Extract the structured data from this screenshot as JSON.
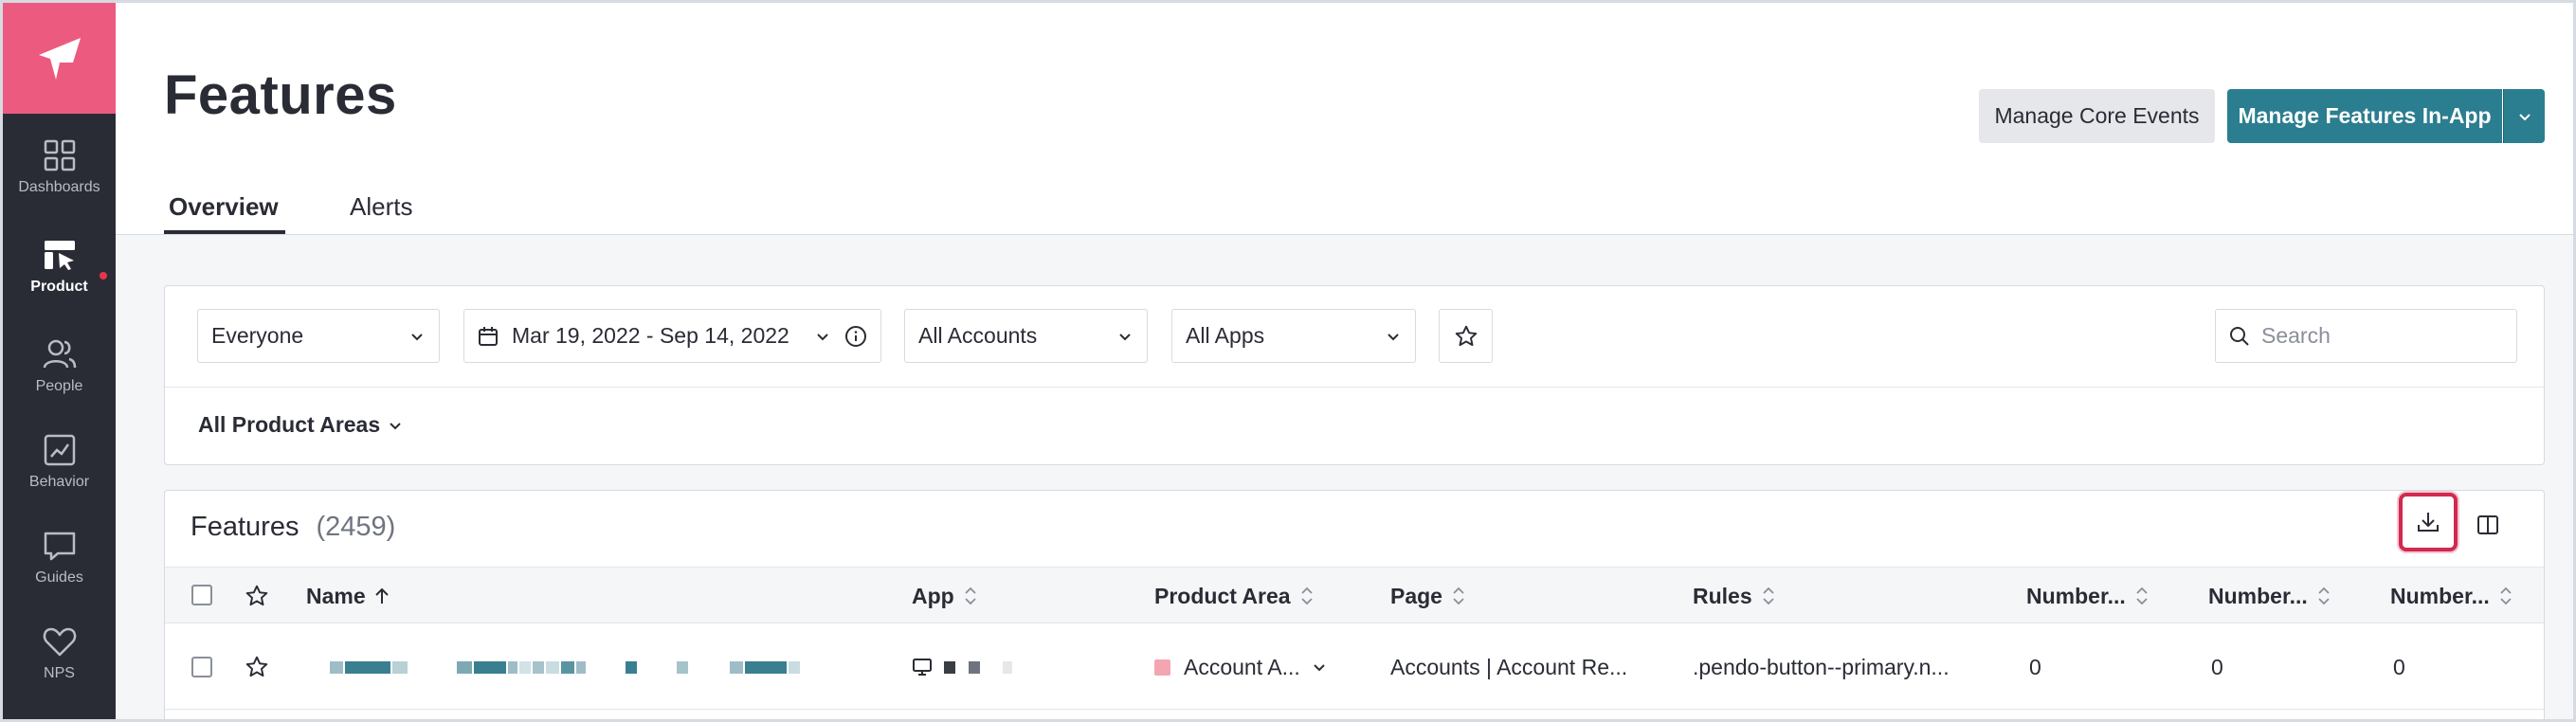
{
  "sidebar": {
    "items": [
      {
        "label": "Dashboards",
        "icon": "grid-icon",
        "active": false
      },
      {
        "label": "Product",
        "icon": "product-icon",
        "active": true,
        "notification": true
      },
      {
        "label": "People",
        "icon": "people-icon",
        "active": false
      },
      {
        "label": "Behavior",
        "icon": "chart-icon",
        "active": false
      },
      {
        "label": "Guides",
        "icon": "message-icon",
        "active": false
      },
      {
        "label": "NPS",
        "icon": "heart-icon",
        "active": false
      }
    ]
  },
  "header": {
    "title": "Features",
    "secondary_button": "Manage Core Events",
    "primary_button": "Manage Features In-App"
  },
  "tabs": [
    {
      "label": "Overview",
      "active": true
    },
    {
      "label": "Alerts",
      "active": false
    }
  ],
  "filters": {
    "segment": "Everyone",
    "date_range": "Mar 19, 2022 - Sep 14, 2022",
    "accounts": "All Accounts",
    "apps": "All Apps",
    "product_areas": "All Product Areas",
    "search_placeholder": "Search"
  },
  "table": {
    "title": "Features",
    "count": "(2459)",
    "columns": [
      "Name",
      "App",
      "Product Area",
      "Page",
      "Rules",
      "Number...",
      "Number...",
      "Number..."
    ],
    "rows": [
      {
        "product_area": "Account A...",
        "page": "Accounts | Account Re...",
        "rules": ".pendo-button--primary.n...",
        "n1": "0",
        "n2": "0",
        "n3": "0"
      }
    ]
  },
  "colors": {
    "sidebar_bg": "#2a2c35",
    "logo_bg": "#ec5b7f",
    "primary": "#2b7e8f",
    "highlight": "#d1294f",
    "product_area_swatch": "#f4a6b0"
  }
}
